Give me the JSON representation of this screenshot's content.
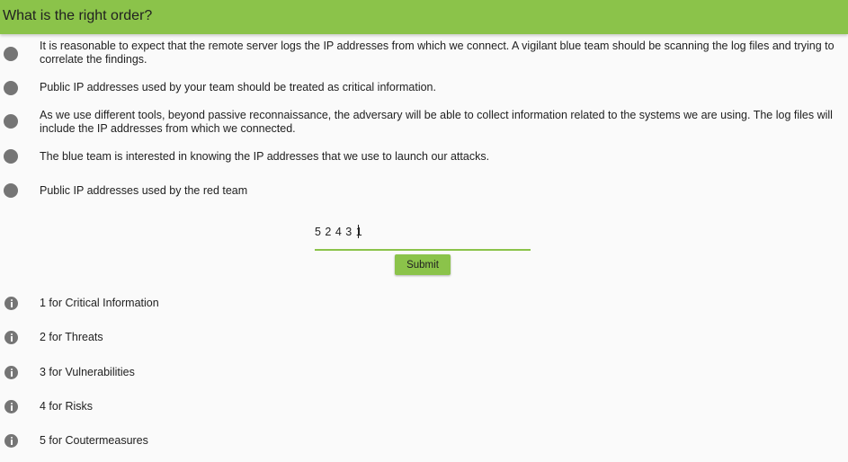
{
  "header": {
    "title": "What is the right order?"
  },
  "items": [
    {
      "text": "It is reasonable to expect that the remote server logs the IP addresses from which we connect. A vigilant blue team should be scanning the log files and trying to correlate the findings."
    },
    {
      "text": "Public IP addresses used by your team should be treated as critical information."
    },
    {
      "text": "As we use different tools, beyond passive reconnaissance, the adversary will be able to collect information related to the systems we are using. The log files will include the IP addresses from which we connected."
    },
    {
      "text": "The blue team is interested in knowing the IP addresses that we use to launch our attacks."
    },
    {
      "text": "Public IP addresses used by the red team"
    }
  ],
  "answer": {
    "value": "5 2 4 3 1"
  },
  "submit_label": "Submit",
  "hints": [
    {
      "text": "1 for Critical Information"
    },
    {
      "text": "2 for Threats"
    },
    {
      "text": "3 for Vulnerabilities"
    },
    {
      "text": "4 for Risks"
    },
    {
      "text": "5 for Coutermeasures"
    }
  ],
  "colors": {
    "accent": "#8bc34a",
    "icon": "#757575",
    "background": "#fafafa"
  }
}
